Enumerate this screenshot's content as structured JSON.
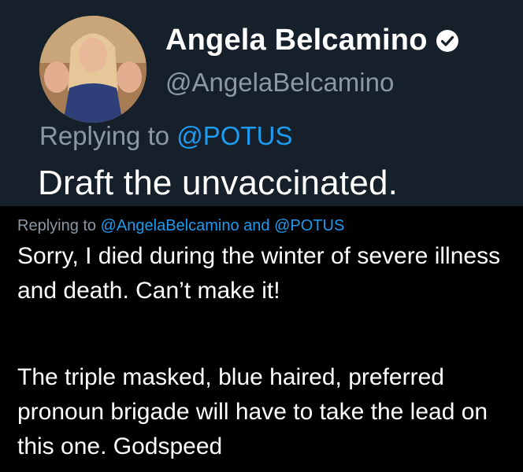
{
  "tweet": {
    "author_name": "Angela Belcamino",
    "author_handle": "@AngelaBelcamino",
    "replying_prefix": "Replying to",
    "replying_mention": "@POTUS",
    "text": "Draft the unvaccinated.",
    "verified_icon": "verified-badge-icon",
    "avatar": "profile-avatar"
  },
  "reply": {
    "replying_prefix": "Replying to",
    "mention_1": "@AngelaBelcamino",
    "conjunction": "and",
    "mention_2": "@POTUS",
    "paragraph_1": "Sorry, I died during the winter of severe illness and death. Can’t make it!",
    "paragraph_2": "The triple masked, blue haired, preferred pronoun brigade will have to take the lead on this one. Godspeed"
  },
  "colors": {
    "top_background": "#15202b",
    "bottom_background": "#000000",
    "secondary_text": "#8b98a5",
    "link": "#1d9bf0",
    "primary_text": "#ffffff"
  }
}
